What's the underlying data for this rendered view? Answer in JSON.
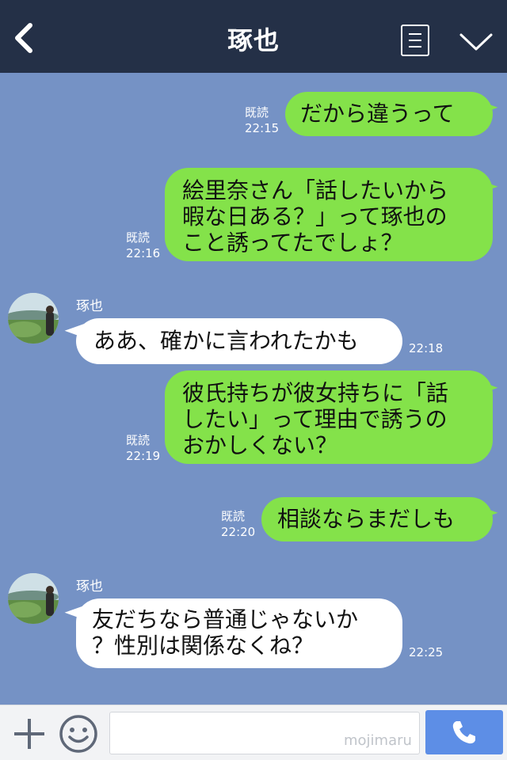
{
  "header": {
    "title": "琢也",
    "back_icon": "chevron-left-icon",
    "menu_icon": "menu-icon",
    "dropdown_icon": "chevron-down-icon",
    "background": "#243047"
  },
  "colors": {
    "chat_background": "#7592c5",
    "sent_bubble": "#84e24a",
    "received_bubble": "#ffffff",
    "call_button": "#5d8ee6"
  },
  "messages": [
    {
      "side": "sent",
      "text": "だから違うって",
      "read": "既読",
      "time": "22:15"
    },
    {
      "side": "sent",
      "text": "絵里奈さん「話したいから\n暇な日ある？」って琢也の\nこと誘ってたでしょ？",
      "read": "既読",
      "time": "22:16"
    },
    {
      "side": "received",
      "sender": "琢也",
      "text": "ああ、確かに言われたかも",
      "time": "22:18"
    },
    {
      "side": "sent",
      "text": "彼氏持ちが彼女持ちに「話\nしたい」って理由で誘うの\nおかしくない？",
      "read": "既読",
      "time": "22:19"
    },
    {
      "side": "sent",
      "text": "相談ならまだしも",
      "read": "既読",
      "time": "22:20"
    },
    {
      "side": "received",
      "sender": "琢也",
      "text": "友だちなら普通じゃないか\n？性別は関係なくね？",
      "time": "22:25"
    }
  ],
  "footer": {
    "plus_icon": "plus-icon",
    "emoji_icon": "smile-icon",
    "input_value": "",
    "watermark": "mojimaru",
    "call_icon": "phone-icon"
  }
}
